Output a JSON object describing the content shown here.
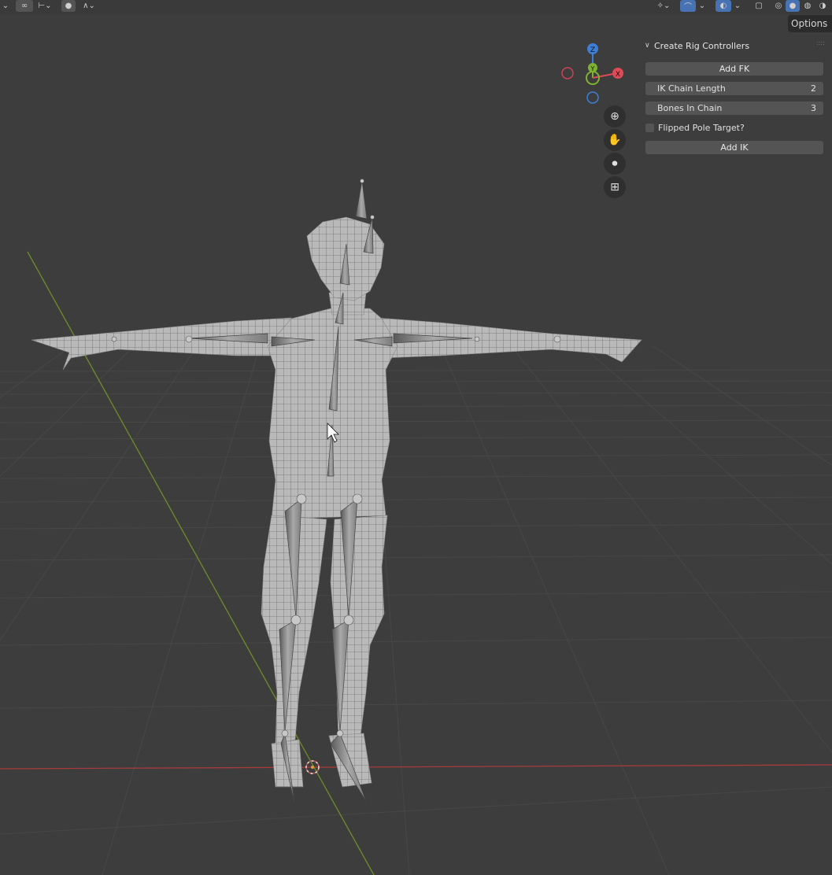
{
  "topbar": {
    "icons": [
      "cursor-icon",
      "link-icon",
      "snap-icon",
      "proportional-edit-icon",
      "falloff-icon",
      "gizmo-icon",
      "overlay-icon",
      "xray-icon",
      "wireframe-shading-icon",
      "solid-shading-icon",
      "material-shading-icon",
      "rendered-shading-icon"
    ]
  },
  "options_tab": {
    "label": "Options"
  },
  "panel": {
    "title": "Create Rig Controllers",
    "add_fk_label": "Add FK",
    "ik_chain_length": {
      "label": "IK Chain Length",
      "value": "2"
    },
    "bones_in_chain": {
      "label": "Bones In Chain",
      "value": "3"
    },
    "flipped_pole_target": {
      "label": "Flipped Pole Target?",
      "checked": false
    },
    "add_ik_label": "Add IK"
  },
  "gizmo": {
    "z_label": "Z",
    "y_label": "Y",
    "x_label": "X",
    "colors": {
      "x": "#e04a57",
      "y": "#7eb32f",
      "z": "#3e7fd6"
    }
  },
  "nav_buttons": [
    "zoom-icon",
    "pan-hand-icon",
    "camera-view-icon",
    "perspective-grid-icon"
  ],
  "colors": {
    "viewport_bg": "#3d3d3d",
    "panel_button": "#545454",
    "accent": "#4772b3",
    "x_axis": "#c24a4a",
    "y_axis": "#6c8e2a"
  }
}
